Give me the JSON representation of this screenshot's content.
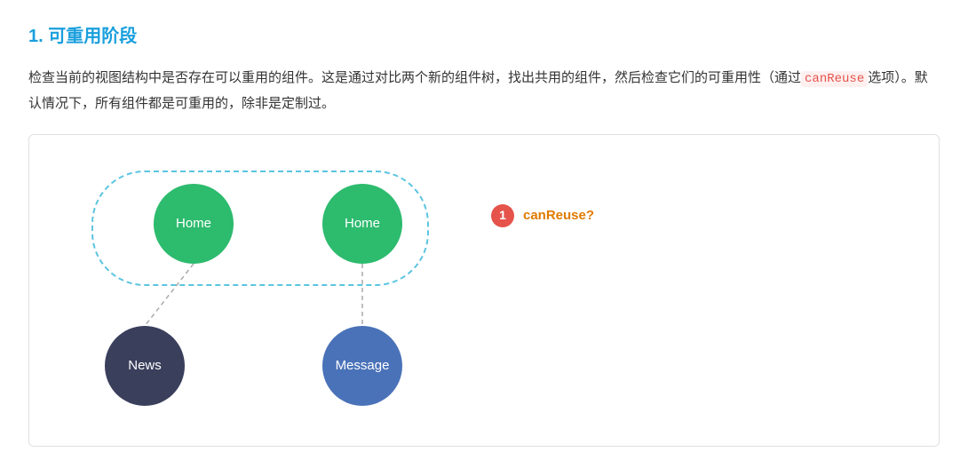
{
  "section": {
    "title": "1. 可重用阶段",
    "description_part1": "检查当前的视图结构中是否存在可以重用的组件。这是通过对比两个新的组件树，找出共用的组件，然后检查它们的可重用性（通过",
    "code_token": "canReuse",
    "description_part2": "选项）。默认情况下，所有组件都是可重用的，除非是定制过。",
    "nodes": {
      "home_left": "Home",
      "home_right": "Home",
      "news": "News",
      "message": "Message"
    },
    "annotation": {
      "badge": "1",
      "label": "canReuse?"
    }
  }
}
